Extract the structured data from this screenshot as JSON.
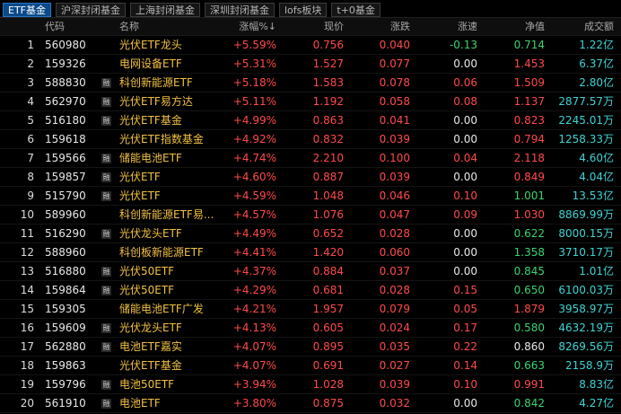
{
  "tabs": [
    {
      "label": "ETF基金",
      "active": true
    },
    {
      "label": "沪深封闭基金",
      "active": false
    },
    {
      "label": "上海封闭基金",
      "active": false
    },
    {
      "label": "深圳封闭基金",
      "active": false
    },
    {
      "label": "lofs板块",
      "active": false
    },
    {
      "label": "t+0基金",
      "active": false
    }
  ],
  "columns": {
    "code": "代码",
    "name": "名称",
    "change_pct": "涨幅%↓",
    "price": "现价",
    "change": "涨跌",
    "speed": "涨速",
    "nav": "净值",
    "volume": "成交额"
  },
  "colors": {
    "up": "#ff4a4a",
    "down": "#3bd36e",
    "flat": "#e8e8e8",
    "name": "#f0c040",
    "volume": "#3ed3d3"
  },
  "badge_label": "融",
  "rows": [
    {
      "idx": "1",
      "code": "560980",
      "badge": false,
      "name": "光伏ETF龙头",
      "pct": "+5.59%",
      "price": "0.756",
      "chg": "0.040",
      "speed": "-0.13",
      "speed_dir": "down",
      "nav": "0.714",
      "nav_dir": "down",
      "vol": "1.22亿"
    },
    {
      "idx": "2",
      "code": "159326",
      "badge": false,
      "name": "电网设备ETF",
      "pct": "+5.31%",
      "price": "1.527",
      "chg": "0.077",
      "speed": "0.00",
      "speed_dir": "flat",
      "nav": "1.453",
      "nav_dir": "up",
      "vol": "6.37亿"
    },
    {
      "idx": "3",
      "code": "588830",
      "badge": true,
      "name": "科创新能源ETF",
      "pct": "+5.18%",
      "price": "1.583",
      "chg": "0.078",
      "speed": "0.06",
      "speed_dir": "up",
      "nav": "1.509",
      "nav_dir": "up",
      "vol": "2.80亿"
    },
    {
      "idx": "4",
      "code": "562970",
      "badge": true,
      "name": "光伏ETF易方达",
      "pct": "+5.11%",
      "price": "1.192",
      "chg": "0.058",
      "speed": "0.08",
      "speed_dir": "up",
      "nav": "1.137",
      "nav_dir": "up",
      "vol": "2877.57万"
    },
    {
      "idx": "5",
      "code": "516180",
      "badge": true,
      "name": "光伏ETF基金",
      "pct": "+4.99%",
      "price": "0.863",
      "chg": "0.041",
      "speed": "0.00",
      "speed_dir": "flat",
      "nav": "0.823",
      "nav_dir": "up",
      "vol": "2245.01万"
    },
    {
      "idx": "6",
      "code": "159618",
      "badge": false,
      "name": "光伏ETF指数基金",
      "pct": "+4.92%",
      "price": "0.832",
      "chg": "0.039",
      "speed": "0.00",
      "speed_dir": "flat",
      "nav": "0.794",
      "nav_dir": "up",
      "vol": "1258.33万"
    },
    {
      "idx": "7",
      "code": "159566",
      "badge": true,
      "name": "储能电池ETF",
      "pct": "+4.74%",
      "price": "2.210",
      "chg": "0.100",
      "speed": "0.04",
      "speed_dir": "up",
      "nav": "2.118",
      "nav_dir": "up",
      "vol": "4.60亿"
    },
    {
      "idx": "8",
      "code": "159857",
      "badge": true,
      "name": "光伏ETF",
      "pct": "+4.60%",
      "price": "0.887",
      "chg": "0.039",
      "speed": "0.00",
      "speed_dir": "flat",
      "nav": "0.849",
      "nav_dir": "up",
      "vol": "4.04亿"
    },
    {
      "idx": "9",
      "code": "515790",
      "badge": true,
      "name": "光伏ETF",
      "pct": "+4.59%",
      "price": "1.048",
      "chg": "0.046",
      "speed": "0.10",
      "speed_dir": "up",
      "nav": "1.001",
      "nav_dir": "down",
      "vol": "13.53亿"
    },
    {
      "idx": "10",
      "code": "589960",
      "badge": false,
      "name": "科创新能源ETF易...",
      "pct": "+4.57%",
      "price": "1.076",
      "chg": "0.047",
      "speed": "0.09",
      "speed_dir": "up",
      "nav": "1.030",
      "nav_dir": "up",
      "vol": "8869.99万"
    },
    {
      "idx": "11",
      "code": "516290",
      "badge": true,
      "name": "光伏龙头ETF",
      "pct": "+4.49%",
      "price": "0.652",
      "chg": "0.028",
      "speed": "0.00",
      "speed_dir": "flat",
      "nav": "0.622",
      "nav_dir": "down",
      "vol": "8000.15万"
    },
    {
      "idx": "12",
      "code": "588960",
      "badge": false,
      "name": "科创板新能源ETF",
      "pct": "+4.41%",
      "price": "1.420",
      "chg": "0.060",
      "speed": "0.00",
      "speed_dir": "flat",
      "nav": "1.358",
      "nav_dir": "down",
      "vol": "3710.17万"
    },
    {
      "idx": "13",
      "code": "516880",
      "badge": true,
      "name": "光伏50ETF",
      "pct": "+4.37%",
      "price": "0.884",
      "chg": "0.037",
      "speed": "0.00",
      "speed_dir": "flat",
      "nav": "0.845",
      "nav_dir": "down",
      "vol": "1.01亿"
    },
    {
      "idx": "14",
      "code": "159864",
      "badge": true,
      "name": "光伏50ETF",
      "pct": "+4.29%",
      "price": "0.681",
      "chg": "0.028",
      "speed": "0.15",
      "speed_dir": "up",
      "nav": "0.650",
      "nav_dir": "down",
      "vol": "6100.03万"
    },
    {
      "idx": "15",
      "code": "159305",
      "badge": false,
      "name": "储能电池ETF广发",
      "pct": "+4.21%",
      "price": "1.957",
      "chg": "0.079",
      "speed": "0.05",
      "speed_dir": "up",
      "nav": "1.879",
      "nav_dir": "up",
      "vol": "3958.97万"
    },
    {
      "idx": "16",
      "code": "159609",
      "badge": true,
      "name": "光伏龙头ETF",
      "pct": "+4.13%",
      "price": "0.605",
      "chg": "0.024",
      "speed": "0.17",
      "speed_dir": "up",
      "nav": "0.580",
      "nav_dir": "down",
      "vol": "4632.19万"
    },
    {
      "idx": "17",
      "code": "562880",
      "badge": true,
      "name": "电池ETF嘉实",
      "pct": "+4.07%",
      "price": "0.895",
      "chg": "0.035",
      "speed": "0.22",
      "speed_dir": "up",
      "nav": "0.860",
      "nav_dir": "flat",
      "vol": "8269.56万"
    },
    {
      "idx": "18",
      "code": "159863",
      "badge": false,
      "name": "光伏ETF基金",
      "pct": "+4.07%",
      "price": "0.691",
      "chg": "0.027",
      "speed": "0.14",
      "speed_dir": "up",
      "nav": "0.663",
      "nav_dir": "down",
      "vol": "2158.9万"
    },
    {
      "idx": "19",
      "code": "159796",
      "badge": true,
      "name": "电池50ETF",
      "pct": "+3.94%",
      "price": "1.028",
      "chg": "0.039",
      "speed": "0.10",
      "speed_dir": "up",
      "nav": "0.991",
      "nav_dir": "up",
      "vol": "8.83亿"
    },
    {
      "idx": "20",
      "code": "561910",
      "badge": true,
      "name": "电池ETF",
      "pct": "+3.80%",
      "price": "0.875",
      "chg": "0.032",
      "speed": "0.00",
      "speed_dir": "flat",
      "nav": "0.842",
      "nav_dir": "down",
      "vol": "4.27亿"
    }
  ]
}
